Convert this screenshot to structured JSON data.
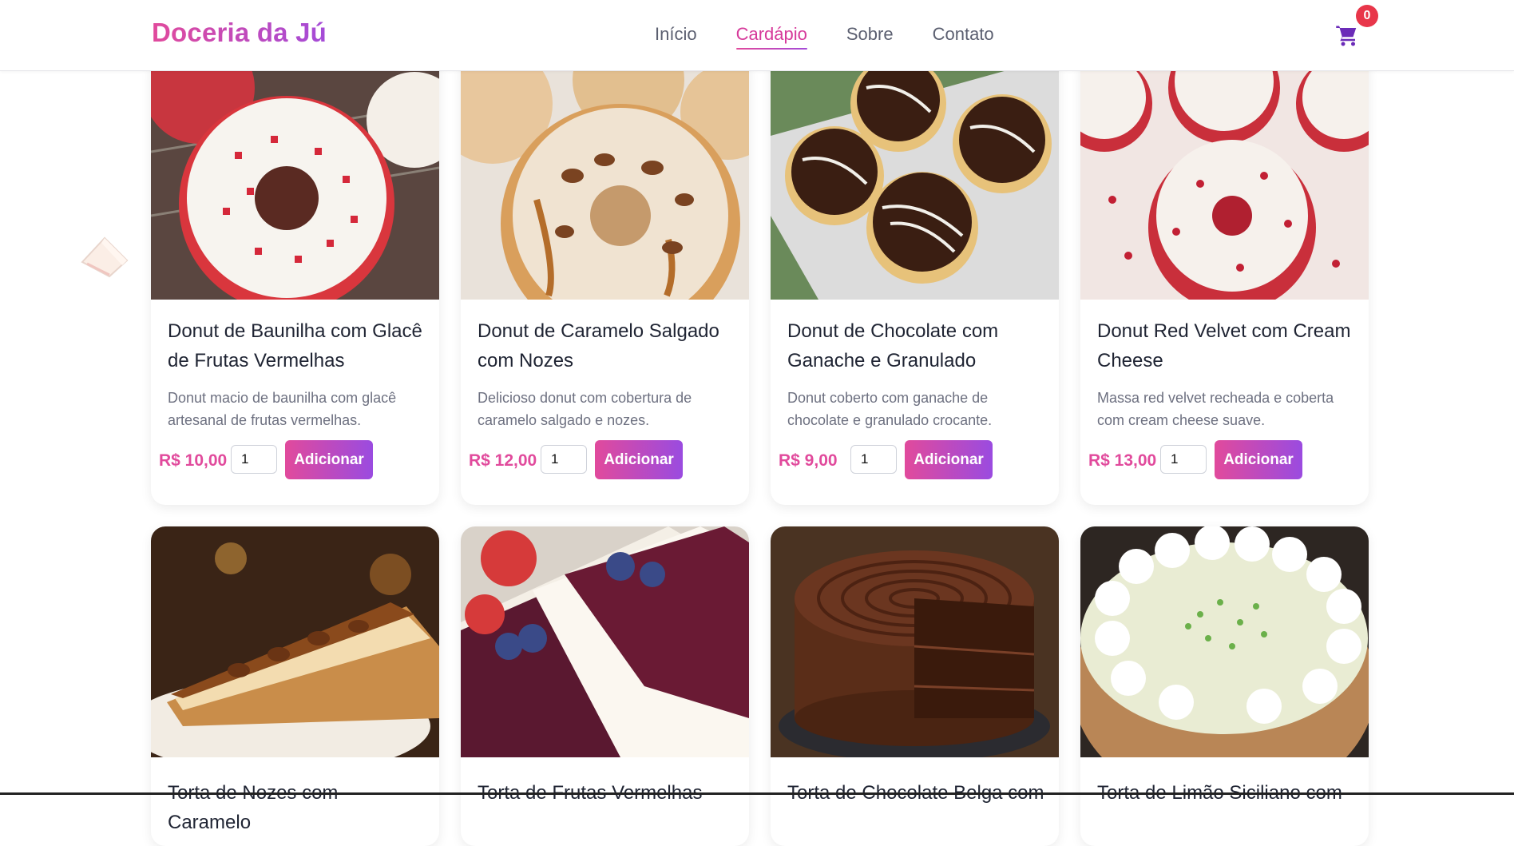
{
  "header": {
    "brand": "Doceria da Jú",
    "nav": [
      "Início",
      "Cardápio",
      "Sobre",
      "Contato"
    ],
    "active_nav": "Cardápio",
    "cart_count": "0"
  },
  "products": [
    {
      "title": "Donut de Baunilha com Glacê de Frutas Vermelhas",
      "description": "Donut macio de baunilha com glacê artesanal de frutas vermelhas.",
      "price": "R$ 10,00",
      "qty": "1",
      "button": "Adicionar"
    },
    {
      "title": "Donut de Caramelo Salgado com Nozes",
      "description": "Delicioso donut com cobertura de caramelo salgado e nozes.",
      "price": "R$ 12,00",
      "qty": "1",
      "button": "Adicionar"
    },
    {
      "title": "Donut de Chocolate com Ganache e Granulado",
      "description": "Donut coberto com ganache de chocolate e granulado crocante.",
      "price": "R$ 9,00",
      "qty": "1",
      "button": "Adicionar"
    },
    {
      "title": "Donut Red Velvet com Cream Cheese",
      "description": "Massa red velvet recheada e coberta com cream cheese suave.",
      "price": "R$ 13,00",
      "qty": "1",
      "button": "Adicionar"
    },
    {
      "title": "Torta de Nozes com Caramelo"
    },
    {
      "title": "Torta de Frutas Vermelhas"
    },
    {
      "title": "Torta de Chocolate Belga com"
    },
    {
      "title": "Torta de Limão Siciliano com"
    }
  ],
  "colors": {
    "brand_gradient_start": "#e14a9c",
    "brand_gradient_end": "#a44bd8",
    "price": "#e14a9c",
    "cart_icon": "#6b2bb8",
    "badge": "#e8364a"
  },
  "icons": {
    "cart": "cart-icon",
    "decoration": "cake-slice-icon"
  }
}
